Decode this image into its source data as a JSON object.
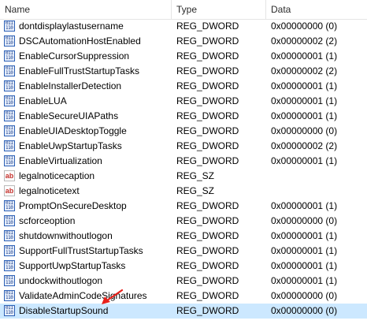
{
  "columns": {
    "name": "Name",
    "type": "Type",
    "data": "Data"
  },
  "rows": [
    {
      "name": "dontdisplaylastusername",
      "type": "REG_DWORD",
      "data": "0x00000000 (0)",
      "icon": "dword-icon"
    },
    {
      "name": "DSCAutomationHostEnabled",
      "type": "REG_DWORD",
      "data": "0x00000002 (2)",
      "icon": "dword-icon"
    },
    {
      "name": "EnableCursorSuppression",
      "type": "REG_DWORD",
      "data": "0x00000001 (1)",
      "icon": "dword-icon"
    },
    {
      "name": "EnableFullTrustStartupTasks",
      "type": "REG_DWORD",
      "data": "0x00000002 (2)",
      "icon": "dword-icon"
    },
    {
      "name": "EnableInstallerDetection",
      "type": "REG_DWORD",
      "data": "0x00000001 (1)",
      "icon": "dword-icon"
    },
    {
      "name": "EnableLUA",
      "type": "REG_DWORD",
      "data": "0x00000001 (1)",
      "icon": "dword-icon"
    },
    {
      "name": "EnableSecureUIAPaths",
      "type": "REG_DWORD",
      "data": "0x00000001 (1)",
      "icon": "dword-icon"
    },
    {
      "name": "EnableUIADesktopToggle",
      "type": "REG_DWORD",
      "data": "0x00000000 (0)",
      "icon": "dword-icon"
    },
    {
      "name": "EnableUwpStartupTasks",
      "type": "REG_DWORD",
      "data": "0x00000002 (2)",
      "icon": "dword-icon"
    },
    {
      "name": "EnableVirtualization",
      "type": "REG_DWORD",
      "data": "0x00000001 (1)",
      "icon": "dword-icon"
    },
    {
      "name": "legalnoticecaption",
      "type": "REG_SZ",
      "data": "",
      "icon": "string-icon"
    },
    {
      "name": "legalnoticetext",
      "type": "REG_SZ",
      "data": "",
      "icon": "string-icon"
    },
    {
      "name": "PromptOnSecureDesktop",
      "type": "REG_DWORD",
      "data": "0x00000001 (1)",
      "icon": "dword-icon"
    },
    {
      "name": "scforceoption",
      "type": "REG_DWORD",
      "data": "0x00000000 (0)",
      "icon": "dword-icon"
    },
    {
      "name": "shutdownwithoutlogon",
      "type": "REG_DWORD",
      "data": "0x00000001 (1)",
      "icon": "dword-icon"
    },
    {
      "name": "SupportFullTrustStartupTasks",
      "type": "REG_DWORD",
      "data": "0x00000001 (1)",
      "icon": "dword-icon"
    },
    {
      "name": "SupportUwpStartupTasks",
      "type": "REG_DWORD",
      "data": "0x00000001 (1)",
      "icon": "dword-icon"
    },
    {
      "name": "undockwithoutlogon",
      "type": "REG_DWORD",
      "data": "0x00000001 (1)",
      "icon": "dword-icon"
    },
    {
      "name": "ValidateAdminCodeSignatures",
      "type": "REG_DWORD",
      "data": "0x00000000 (0)",
      "icon": "dword-icon"
    },
    {
      "name": "DisableStartupSound",
      "type": "REG_DWORD",
      "data": "0x00000000 (0)",
      "icon": "dword-icon",
      "selected": true
    }
  ],
  "colors": {
    "selection": "#cce8ff",
    "annotation_arrow": "#e8201a"
  }
}
